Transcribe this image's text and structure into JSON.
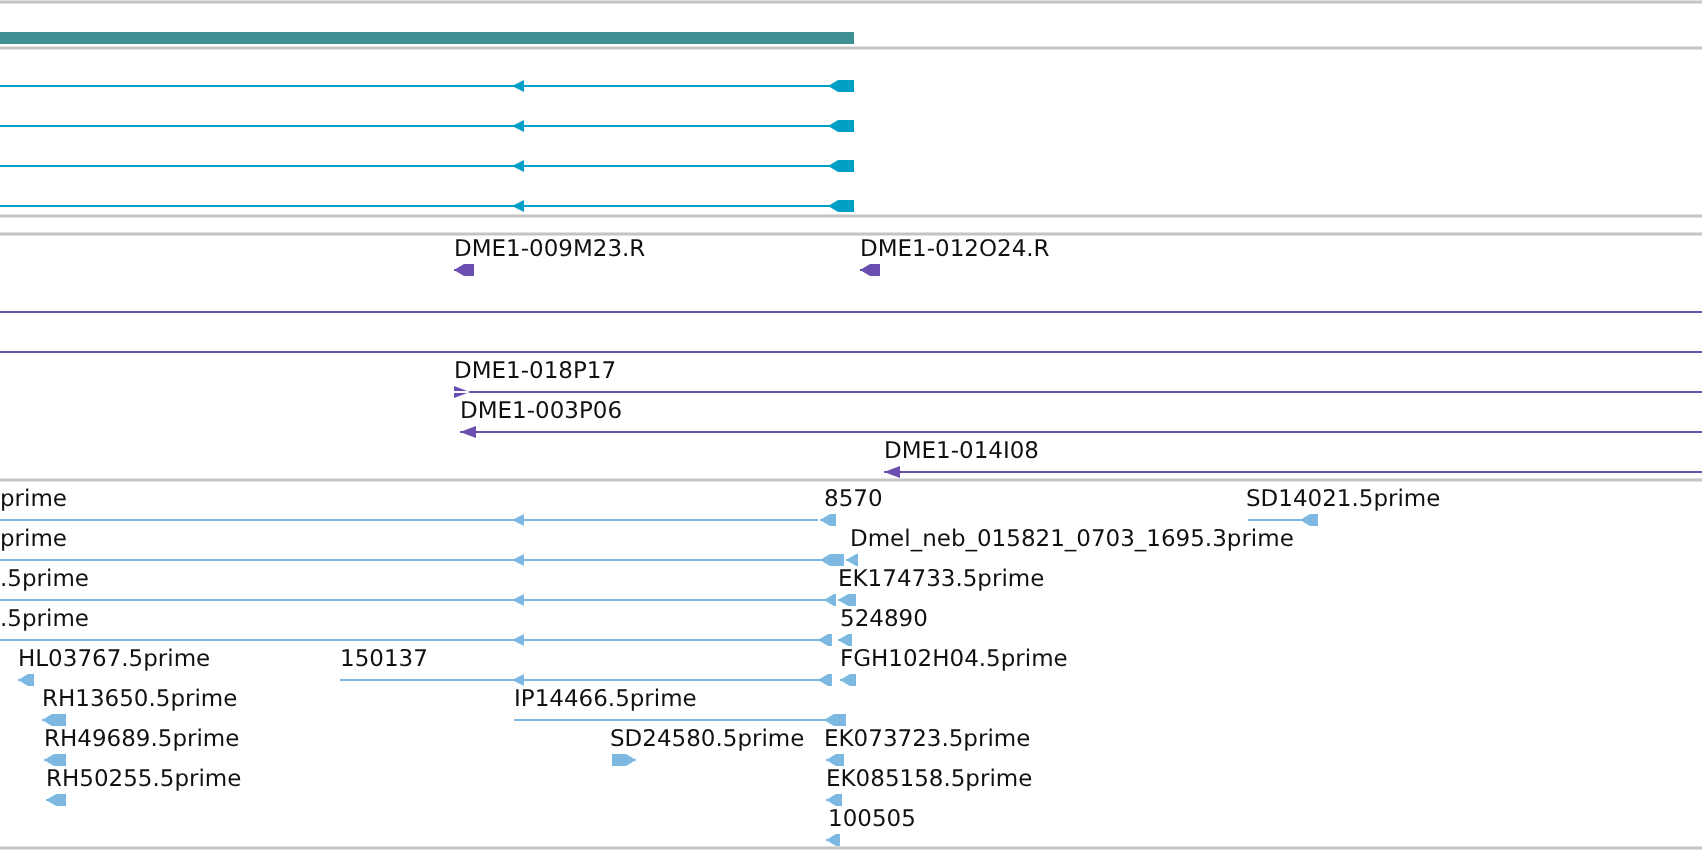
{
  "tracks": [
    {
      "kind": "gene"
    },
    {
      "kind": "transcripts",
      "features": [
        {
          "reverse": true
        },
        {
          "reverse": true
        },
        {
          "reverse": true
        },
        {
          "reverse": true
        }
      ]
    },
    {
      "kind": "clones",
      "features": [
        {
          "kind": "feature",
          "label": "DME1-009M23.R",
          "reverse": true
        },
        {
          "kind": "feature",
          "label": "DME1-012O24.R",
          "reverse": true
        },
        {
          "kind": "line"
        },
        {
          "kind": "line"
        },
        {
          "kind": "feature",
          "label": "DME1-018P17",
          "reverse": false
        },
        {
          "kind": "feature",
          "label": "DME1-003P06",
          "reverse": true
        },
        {
          "kind": "feature",
          "label": "DME1-014I08",
          "reverse": true
        }
      ]
    },
    {
      "kind": "ests",
      "features": [
        {
          "label": "prime",
          "reverse": true
        },
        {
          "label": "8570",
          "reverse": true
        },
        {
          "label": "SD14021.5prime",
          "reverse": true
        },
        {
          "label": "prime",
          "reverse": true
        },
        {
          "label": "Dmel_neb_015821_0703_1695.3prime",
          "reverse": true
        },
        {
          "label": ".5prime",
          "reverse": true
        },
        {
          "label": "EK174733.5prime",
          "reverse": true
        },
        {
          "label": ".5prime",
          "reverse": true
        },
        {
          "label": "524890",
          "reverse": true
        },
        {
          "label": "HL03767.5prime",
          "reverse": true
        },
        {
          "label": "150137",
          "reverse": true
        },
        {
          "label": "FGH102H04.5prime",
          "reverse": true
        },
        {
          "label": "RH13650.5prime",
          "reverse": true
        },
        {
          "label": "IP14466.5prime",
          "reverse": true
        },
        {
          "label": "RH49689.5prime",
          "reverse": true
        },
        {
          "label": "SD24580.5prime",
          "reverse": false
        },
        {
          "label": "EK073723.5prime",
          "reverse": true
        },
        {
          "label": "RH50255.5prime",
          "reverse": true
        },
        {
          "label": "EK085158.5prime",
          "reverse": true
        },
        {
          "label": "100505",
          "reverse": true
        }
      ]
    }
  ]
}
